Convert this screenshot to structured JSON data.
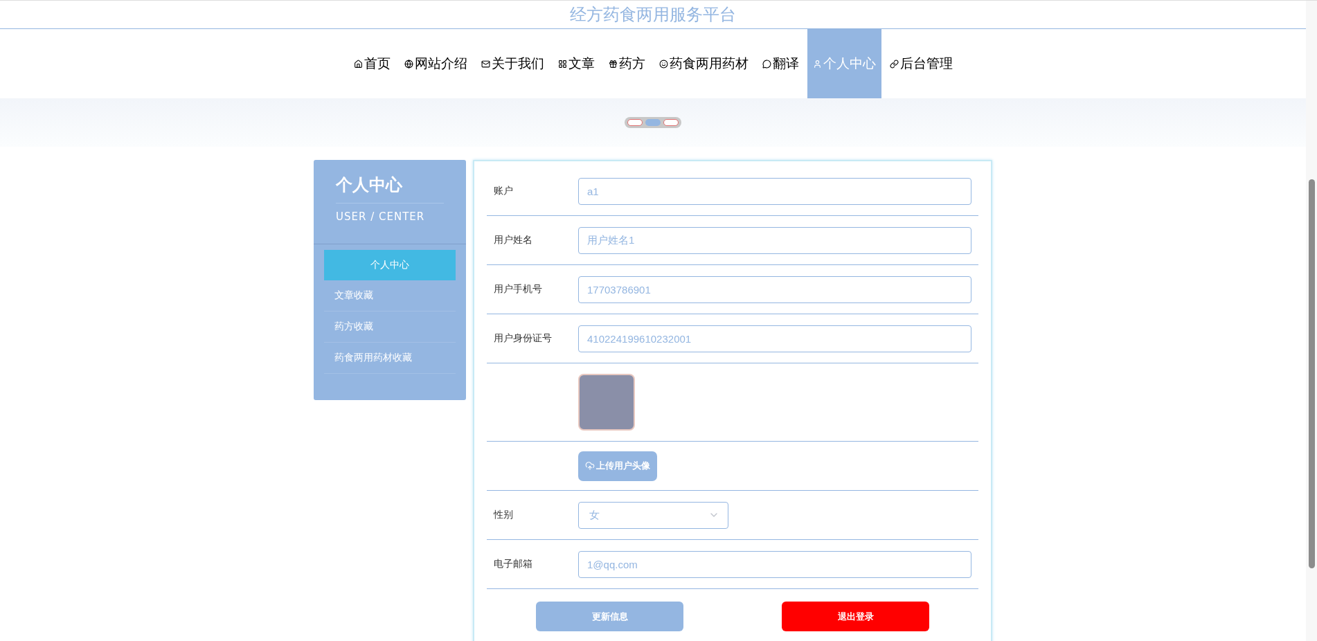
{
  "site_title": "经方药食两用服务平台",
  "nav": [
    {
      "label": "首页",
      "selected": false
    },
    {
      "label": "网站介绍",
      "selected": false
    },
    {
      "label": "关于我们",
      "selected": false
    },
    {
      "label": "文章",
      "selected": false
    },
    {
      "label": "药方",
      "selected": false
    },
    {
      "label": "药食两用药材",
      "selected": false
    },
    {
      "label": "翻译",
      "selected": false
    },
    {
      "label": "个人中心",
      "selected": true
    },
    {
      "label": "后台管理",
      "selected": false
    }
  ],
  "carousel_dots": [
    {
      "selected": false
    },
    {
      "selected": true
    },
    {
      "selected": false
    }
  ],
  "sidebar": {
    "title": "个人中心",
    "subtitle": "USER / CENTER",
    "items": [
      {
        "label": "个人中心",
        "selected": true
      },
      {
        "label": "文章收藏",
        "selected": false
      },
      {
        "label": "药方收藏",
        "selected": false
      },
      {
        "label": "药食两用药材收藏",
        "selected": false
      }
    ]
  },
  "form": {
    "rows": [
      {
        "kind": "input",
        "label": "账户",
        "value": "a1"
      },
      {
        "kind": "input",
        "label": "用户姓名",
        "value": "用户姓名1"
      },
      {
        "kind": "input",
        "label": "用户手机号",
        "value": "17703786901"
      },
      {
        "kind": "input",
        "label": "用户身份证号",
        "value": "410224199610232001"
      },
      {
        "kind": "avatar"
      },
      {
        "kind": "upload",
        "button": "上传用户头像"
      },
      {
        "kind": "select",
        "label": "性别",
        "value": "女"
      },
      {
        "kind": "input",
        "label": "电子邮箱",
        "value": "1@qq.com"
      }
    ],
    "buttons": [
      {
        "label": "更新信息",
        "kind": "primary"
      },
      {
        "label": "退出登录",
        "kind": "danger"
      }
    ]
  }
}
